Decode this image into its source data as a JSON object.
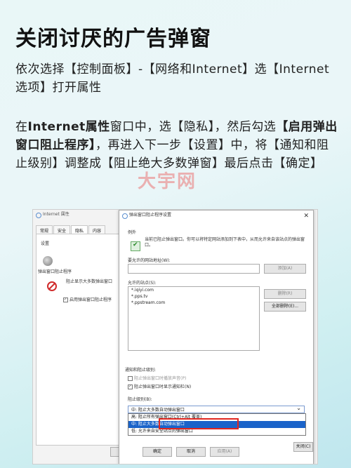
{
  "page": {
    "title": "关闭讨厌的广告弹窗",
    "para1": "依次选择【控制面板】-【网络和Internet】选【Internet选项】打开属性",
    "para2_a": "在",
    "para2_b": "Internet属性",
    "para2_c": "窗口中，选【隐私】，然后勾选",
    "para2_d": "【启用弹出窗口阻止程序】",
    "para2_e": "，再进入下一步【设置】中，将【通知和阻止级别】调整成【阻止绝大多数弹窗】最后点击【确定】",
    "watermark": "大宇网"
  },
  "back_window": {
    "title": "Internet 属性",
    "tabs": [
      "常规",
      "安全",
      "隐私",
      "内容"
    ],
    "settings_label": "设置",
    "popup_group_label": "弹出窗口阻止程序",
    "block_most_label": "阻止显示大多数弹出窗口",
    "enable_popup_label": "启用弹出窗口阻止程序",
    "ok": "确定",
    "cancel": "取消",
    "apply": "应用(A)"
  },
  "front_window": {
    "title": "弹出窗口阻止程序设置",
    "exceptions_label": "例外",
    "exceptions_desc": "当前已阻止弹出窗口。你可以将特定网站添加到下表中，从而允许来自该站点的弹出窗口。",
    "allow_label": "要允许的网站地址(W):",
    "add_button": "添加(A)",
    "allowed_sites_label": "允许的站点(S):",
    "sites": [
      "*.iqiyi.com",
      "*.pps.tv",
      "*.ppstream.com"
    ],
    "remove_button": "删除(R)",
    "remove_all_button": "全部删除(E)...",
    "notify_group_label": "通知和阻止级别:",
    "play_sound_label": "阻止弹出窗口时播放声音(P)",
    "show_bar_label": "阻止弹出窗口时显示通知栏(N)",
    "block_level_label": "阻止级别(B):",
    "block_level_value": "中: 阻止大多数自动弹出窗口",
    "options": [
      "高: 阻止所有弹出窗口(Ctrl+Alt 覆盖)",
      "中: 阻止大多数自动弹出窗口",
      "低: 允许来自安全站点的弹出窗口"
    ],
    "close_button": "关闭(C)"
  }
}
